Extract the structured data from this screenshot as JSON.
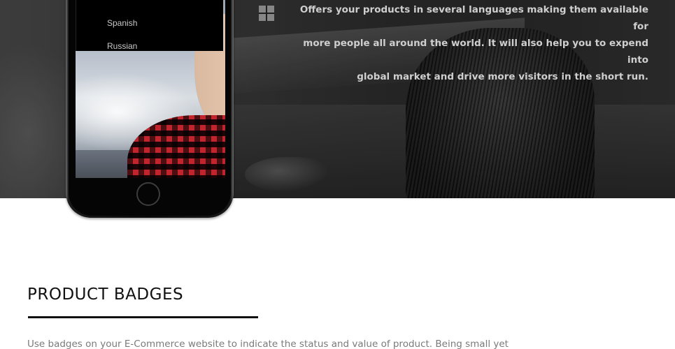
{
  "hero": {
    "description_lines": [
      "Offers your products in several languages making them available for",
      "more people all around the world. It will also help you to expend into",
      "global market and drive more visitors in the short run."
    ]
  },
  "phone": {
    "language_menu": {
      "items": [
        "Spanish",
        "Russian"
      ]
    }
  },
  "badges_section": {
    "title": "PRODUCT BADGES",
    "text": "Use badges on your E-Commerce website to indicate the status and value of product. Being small yet"
  }
}
